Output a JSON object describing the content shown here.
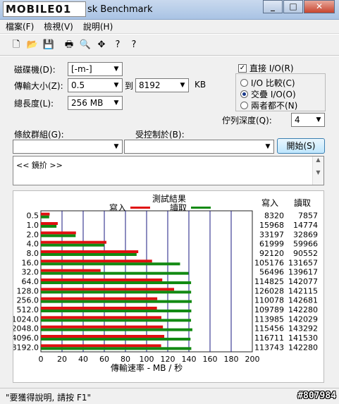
{
  "window": {
    "logo_text": "MOBILE01",
    "title": "sk Benchmark",
    "min_label": "_",
    "max_label": "□",
    "close_label": "✕"
  },
  "menu": [
    "檔案(F)",
    "檢視(V)",
    "說明(H)"
  ],
  "toolbar": {
    "icons": [
      "new-icon",
      "open-icon",
      "save-icon",
      "print-icon",
      "print-preview-icon",
      "move-icon",
      "help-icon",
      "context-help-icon"
    ],
    "glyphs": [
      "🗋",
      "📂",
      "💾",
      "🖶",
      "🔍",
      "✥",
      "?",
      "?"
    ]
  },
  "form": {
    "drive_label": "磁碟機(D):",
    "drive_value": "[-m-]",
    "transfer_label": "傳輸大小(Z):",
    "transfer_from": "0.5",
    "to_label": "到",
    "transfer_to": "8192",
    "kb_label": "KB",
    "length_label": "總長度(L):",
    "length_value": "256 MB",
    "direct_io_label": "直接 I/O(R)",
    "direct_io_checked": true,
    "radio_options": [
      "I/O 比較(C)",
      "交疊 I/O(O)",
      "兩者都不(N)"
    ],
    "radio_selected": 1,
    "queue_label": "佇列深度(Q):",
    "queue_value": "4",
    "group_label": "條紋群組(G):",
    "group_value": "",
    "control_label": "受控制於(B):",
    "control_value": "",
    "start_label": "開始(S)",
    "description": "<< 鏡扴 >>"
  },
  "results": {
    "title": "測試結果",
    "write_legend": "寫入",
    "read_legend": "讀取",
    "write_col": "寫入",
    "read_col": "讀取",
    "write_color": "#e01010",
    "read_color": "#128a12"
  },
  "chart_data": {
    "type": "bar",
    "orientation": "horizontal",
    "categories": [
      "0.5",
      "1.0",
      "2.0",
      "4.0",
      "8.0",
      "16.0",
      "32.0",
      "64.0",
      "128.0",
      "256.0",
      "512.0",
      "1024.0",
      "2048.0",
      "4096.0",
      "8192.0"
    ],
    "series": [
      {
        "name": "寫入",
        "values": [
          8320,
          15968,
          33197,
          61999,
          92120,
          105176,
          56496,
          114825,
          126028,
          110078,
          109789,
          113985,
          115456,
          116711,
          113743
        ]
      },
      {
        "name": "讀取",
        "values": [
          7857,
          14774,
          32869,
          59966,
          90552,
          131657,
          139617,
          142077,
          142115,
          142681,
          142280,
          142029,
          143292,
          141530,
          142280
        ]
      }
    ],
    "xlabel": "傳輸速率 - MB / 秒",
    "xticks": [
      0,
      20,
      40,
      60,
      80,
      100,
      120,
      140,
      160,
      180,
      200
    ],
    "xlim": [
      0,
      200
    ],
    "value_unit_divisor": 1000
  },
  "status": {
    "text": "\"要獲得說明, 請按 F1\"",
    "watermark": "#807984"
  }
}
